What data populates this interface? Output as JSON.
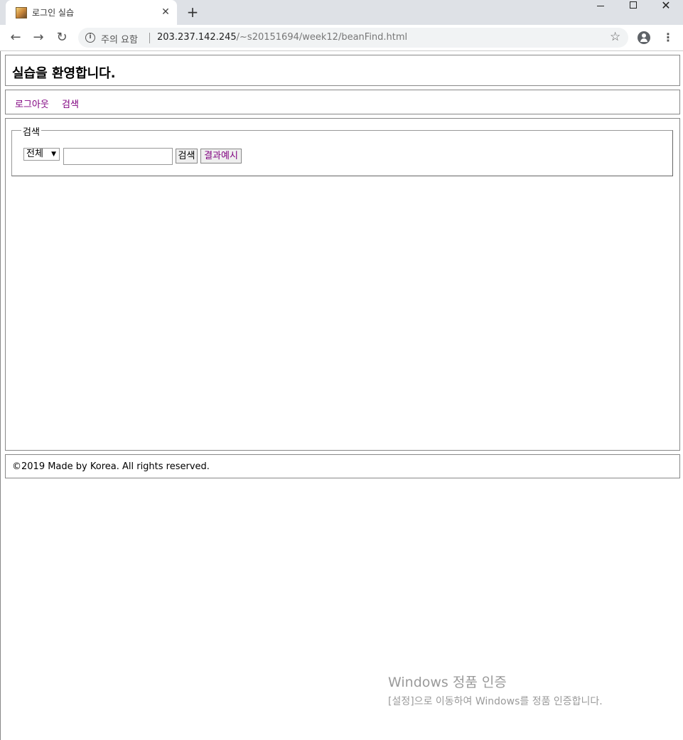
{
  "browser": {
    "tab_title": "로그인 실습",
    "tab_close": "✕",
    "new_tab": "+",
    "security_label": "주의 요함",
    "url_host": "203.237.142.245",
    "url_path": "/~s20151694/week12/beanFind.html"
  },
  "icons": {
    "back": "←",
    "forward": "→",
    "reload": "↻",
    "star": "☆",
    "menu": "⋮",
    "close": "✕",
    "info": "i"
  },
  "page": {
    "header_title": "실습을 환영합니다.",
    "nav": [
      "로그아웃",
      "검색"
    ],
    "search": {
      "legend": "검색",
      "select_value": "전체",
      "input_value": "",
      "search_button": "검색",
      "example_button": "결과예시"
    },
    "footer": "©2019 Made by Korea. All rights reserved."
  },
  "watermark": {
    "title": "Windows 정품 인증",
    "subtitle": "[설정]으로 이동하여 Windows를 정품 인증합니다."
  },
  "colors": {
    "visited_link": "#800080",
    "tabstrip": "#dee1e6",
    "omnibox": "#f1f3f4"
  }
}
